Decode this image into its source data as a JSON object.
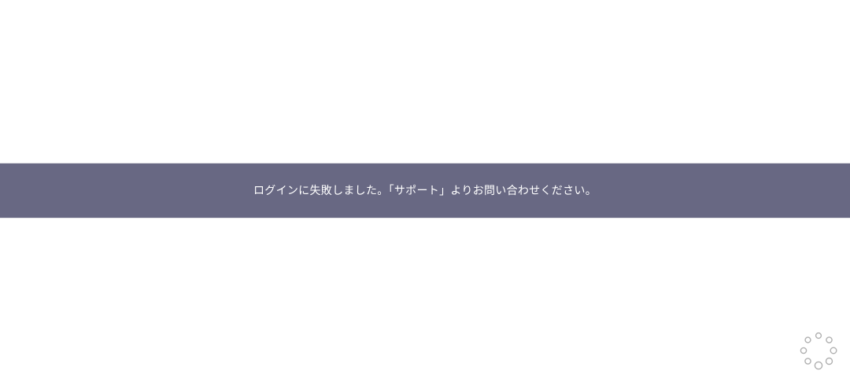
{
  "banner": {
    "message": "ログインに失敗しました。「サポート」よりお問い合わせください。",
    "background_color": "#686883",
    "text_color": "#ffffff"
  },
  "loading_indicator": {
    "icon": "loading-spinner-icon",
    "color": "#b0b0b0"
  }
}
